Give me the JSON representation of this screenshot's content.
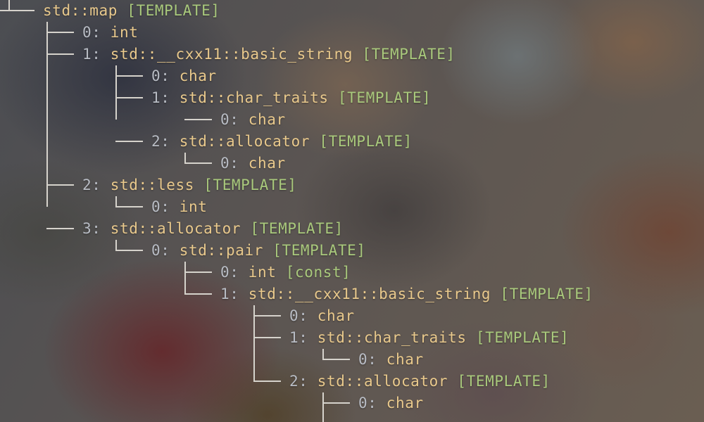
{
  "tree": {
    "nodes": [
      {
        "depth": 0,
        "index": "",
        "type": "std::map",
        "tag": "[TEMPLATE]",
        "last": true,
        "vline_to": 9
      },
      {
        "depth": 1,
        "index": "0:",
        "type": "int",
        "tag": "",
        "last": false,
        "vline_to": null
      },
      {
        "depth": 1,
        "index": "1:",
        "type": "std::__cxx11::basic_string",
        "tag": "[TEMPLATE]",
        "last": false,
        "vline_to": 5
      },
      {
        "depth": 2,
        "index": "0:",
        "type": "char",
        "tag": "",
        "last": false,
        "vline_to": null
      },
      {
        "depth": 2,
        "index": "1:",
        "type": "std::char_traits",
        "tag": "[TEMPLATE]",
        "last": false,
        "vline_to": 4
      },
      {
        "depth": 3,
        "index": "0:",
        "type": "char",
        "tag": "",
        "last": true,
        "vline_to": null
      },
      {
        "depth": 2,
        "index": "2:",
        "type": "std::allocator",
        "tag": "[TEMPLATE]",
        "last": true,
        "vline_to": 7
      },
      {
        "depth": 3,
        "index": "0:",
        "type": "char",
        "tag": "",
        "last": true,
        "vline_to": null
      },
      {
        "depth": 1,
        "index": "2:",
        "type": "std::less",
        "tag": "[TEMPLATE]",
        "last": false,
        "vline_to": 9
      },
      {
        "depth": 2,
        "index": "0:",
        "type": "int",
        "tag": "",
        "last": true,
        "vline_to": null
      },
      {
        "depth": 1,
        "index": "3:",
        "type": "std::allocator",
        "tag": "[TEMPLATE]",
        "last": true,
        "vline_to": 11
      },
      {
        "depth": 2,
        "index": "0:",
        "type": "std::pair",
        "tag": "[TEMPLATE]",
        "last": true,
        "vline_to": 13
      },
      {
        "depth": 3,
        "index": "0:",
        "type": "int",
        "tag": "[const]",
        "last": false,
        "vline_to": null
      },
      {
        "depth": 3,
        "index": "1:",
        "type": "std::__cxx11::basic_string",
        "tag": "[TEMPLATE]",
        "last": true,
        "vline_to": 17
      },
      {
        "depth": 4,
        "index": "0:",
        "type": "char",
        "tag": "",
        "last": false,
        "vline_to": null
      },
      {
        "depth": 4,
        "index": "1:",
        "type": "std::char_traits",
        "tag": "[TEMPLATE]",
        "last": false,
        "vline_to": 16
      },
      {
        "depth": 5,
        "index": "0:",
        "type": "char",
        "tag": "",
        "last": true,
        "vline_to": null
      },
      {
        "depth": 4,
        "index": "2:",
        "type": "std::allocator",
        "tag": "[TEMPLATE]",
        "last": true,
        "vline_to": 19
      },
      {
        "depth": 5,
        "index": "0:",
        "type": "char",
        "tag": "",
        "last": true,
        "vline_to": null
      }
    ]
  }
}
